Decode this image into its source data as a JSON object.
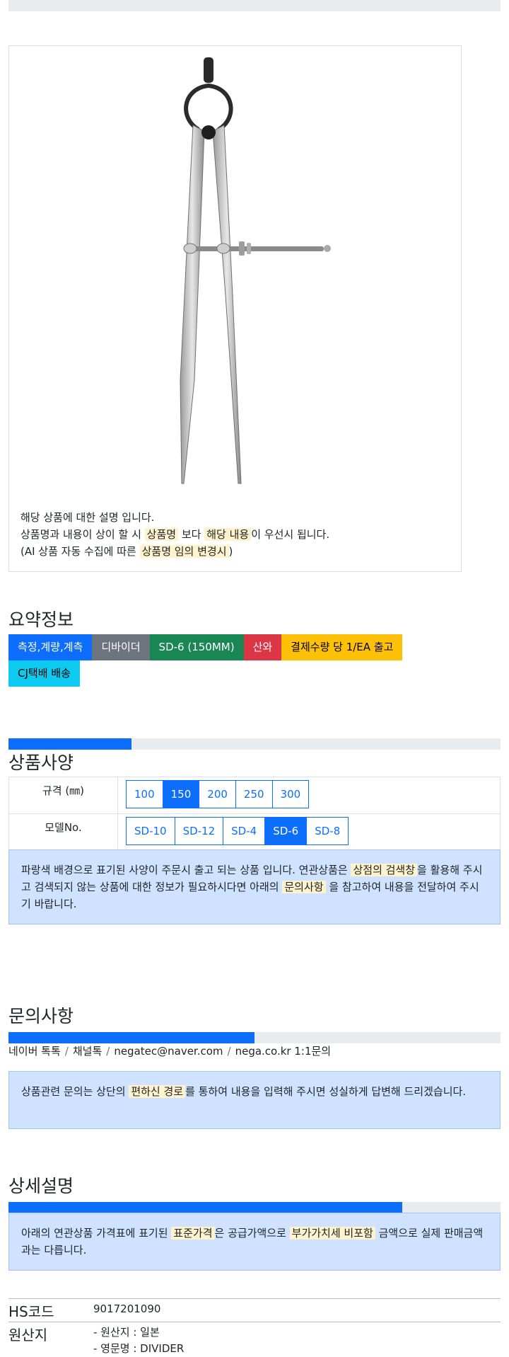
{
  "product_card": {
    "image_label": "divider-product-image",
    "notes": {
      "line1": "해당 상품에 대한 설명 입니다.",
      "line2_pre": "상품명과 내용이 상이 할 시",
      "line2_hl1": "상품명",
      "line2_mid": "보다",
      "line2_hl2": "해당 내용",
      "line2_post": "이 우선시 됩니다.",
      "line3_pre": "(AI 상품 자동 수집에 따른",
      "line3_hl": "상품명 임의 변경시",
      "line3_post": ")"
    }
  },
  "summary": {
    "title": "요약정보",
    "badges": [
      {
        "label": "측정,계량,계측",
        "color": "#0d6efd"
      },
      {
        "label": "디바이더",
        "color": "#6c757d"
      },
      {
        "label": "SD-6 (150MM)",
        "color": "#198754"
      },
      {
        "label": "산와",
        "color": "#dc3545"
      },
      {
        "label": "결제수량 당 1/EA 출고",
        "color": "#ffc107"
      },
      {
        "label": "CJ택배 배송",
        "color": "#0dcaf0"
      }
    ]
  },
  "specs": {
    "progress_percent": 25,
    "title": "상품사양",
    "rows": [
      {
        "label": "규격 (㎜)",
        "options": [
          "100",
          "150",
          "200",
          "250",
          "300"
        ],
        "selected": "150"
      },
      {
        "label": "모델No.",
        "options": [
          "SD-10",
          "SD-12",
          "SD-4",
          "SD-6",
          "SD-8"
        ],
        "selected": "SD-6"
      }
    ],
    "notice": {
      "pre": "파랑색 배경으로 표기된 사양이 주문시 출고 되는 상품 입니다. 연관상품은",
      "hl1": "상점의 검색창",
      "mid": "을 활용해 주시고 검색되지 않는 상품에 대한 정보가 필요하시다면 아래의",
      "hl2": "문의사항",
      "post": "을 참고하여 내용을 전달하여 주시기 바랍니다."
    }
  },
  "inquiry": {
    "title": "문의사항",
    "progress_percent": 50,
    "channels": [
      "네이버 톡톡",
      "채널톡",
      "negatec@naver.com",
      "nega.co.kr 1:1문의"
    ],
    "notice": {
      "pre": "상품관련 문의는 상단의",
      "hl": "편하신 경로",
      "post": "를 통하여 내용을 입력해 주시면 성실하게 답변해 드리겠습니다."
    }
  },
  "detail": {
    "title": "상세설명",
    "progress_percent": 80,
    "notice": {
      "pre": "아래의 연관상품 가격표에 표기된",
      "hl1": "표준가격",
      "mid": "은 공급가액으로",
      "hl2": "부가가치세 비포함",
      "post": "금액으로 실제 판매금액과는 다릅니다."
    },
    "info": [
      {
        "key": "HS코드",
        "values": [
          "9017201090"
        ]
      },
      {
        "key": "원산지",
        "values": [
          "- 원산지 : 일본",
          "- 영문명 : DIVIDER"
        ]
      }
    ]
  }
}
